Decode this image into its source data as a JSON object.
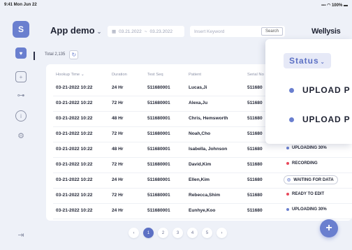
{
  "statusbar": {
    "time": "9:41 Mon Jun 22",
    "system": "100%"
  },
  "app": {
    "title": "App demo",
    "brand": "Wellysis"
  },
  "filters": {
    "date_start": "03.21.2022",
    "date_sep": "~",
    "date_end": "03.23.2022",
    "search_placeholder": "Insert Keyword",
    "search_button": "Search"
  },
  "toolbar": {
    "total": "Total 2,135"
  },
  "table": {
    "headers": {
      "hookup": "Hookup Time",
      "duration": "Duration",
      "test_seq": "Test Seq",
      "patient": "Patient",
      "serial": "Serial No"
    },
    "rows": [
      {
        "hookup": "03-21-2022 10:22",
        "duration": "24 Hr",
        "test_seq": "511680001",
        "patient": "Lucas,Ji",
        "serial": "511680",
        "status": "",
        "status_color": ""
      },
      {
        "hookup": "03-21-2022 10:22",
        "duration": "72 Hr",
        "test_seq": "511680001",
        "patient": "Alexa,Ju",
        "serial": "511680",
        "status": "",
        "status_color": ""
      },
      {
        "hookup": "03-21-2022 10:22",
        "duration": "48 Hr",
        "test_seq": "511680001",
        "patient": "Chris, Hemsworth",
        "serial": "511680",
        "status": "",
        "status_color": ""
      },
      {
        "hookup": "03-21-2022 10:22",
        "duration": "72 Hr",
        "test_seq": "511680001",
        "patient": "Noah,Cho",
        "serial": "511680",
        "status": "",
        "status_color": ""
      },
      {
        "hookup": "03-21-2022 10:22",
        "duration": "48 Hr",
        "test_seq": "511680001",
        "patient": "Isabella, Johnson",
        "serial": "511680",
        "status": "UPLOADING 30%",
        "status_color": "#6a7fcf"
      },
      {
        "hookup": "03-21-2022 10:22",
        "duration": "72 Hr",
        "test_seq": "511680001",
        "patient": "David,Kim",
        "serial": "511680",
        "status": "RECORDING",
        "status_color": "#e8475a"
      },
      {
        "hookup": "03-21-2022 10:22",
        "duration": "24 Hr",
        "test_seq": "511680001",
        "patient": "Ellen,Kim",
        "serial": "511680",
        "status": "WAITING FOR DATA",
        "status_color": "#6a7fcf"
      },
      {
        "hookup": "03-21-2022 10:22",
        "duration": "72 Hr",
        "test_seq": "511680001",
        "patient": "Rebecca,Shim",
        "serial": "511680",
        "status": "READY TO EDIT",
        "status_color": "#e8475a"
      },
      {
        "hookup": "03-21-2022 10:22",
        "duration": "24 Hr",
        "test_seq": "511680001",
        "patient": "Eunhye,Koo",
        "serial": "511680",
        "status": "UPLOADING 30%",
        "status_color": "#6a7fcf"
      }
    ]
  },
  "pagination": {
    "pages": [
      "1",
      "2",
      "3",
      "4",
      "5"
    ],
    "current": "1"
  },
  "fab": {
    "label": "+"
  },
  "status_dropdown": {
    "label": "Status",
    "items": [
      "UPLOAD P",
      "UPLOAD P"
    ]
  },
  "colors": {
    "accent": "#6a7fcf",
    "danger": "#e8475a",
    "text": "#1f2333"
  }
}
